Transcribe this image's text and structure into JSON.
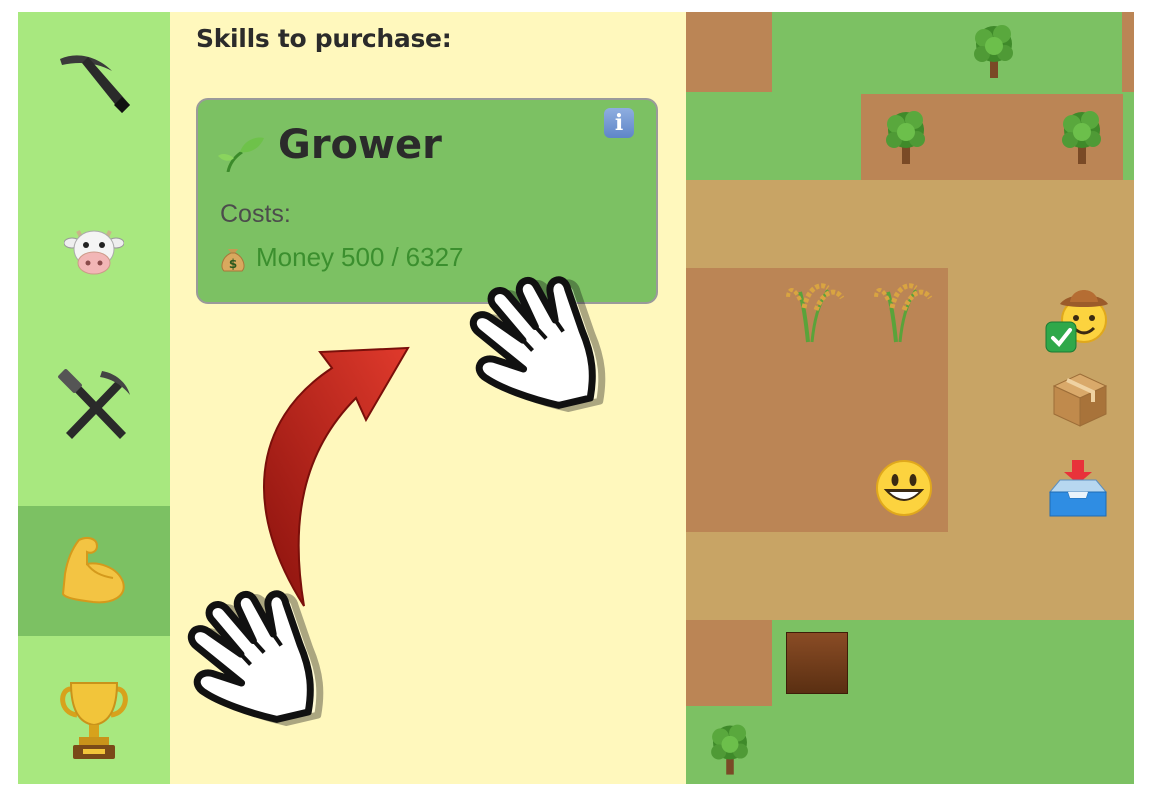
{
  "sidebar": {
    "items": [
      {
        "icon": "pickaxe-icon",
        "active": false
      },
      {
        "icon": "cow-icon",
        "active": false
      },
      {
        "icon": "hammer-and-pick-icon",
        "active": false
      },
      {
        "icon": "flexed-biceps-icon",
        "active": true
      },
      {
        "icon": "trophy-icon",
        "active": false
      }
    ]
  },
  "panel": {
    "title": "Skills to purchase:",
    "skill": {
      "name": "Grower",
      "icon": "seedling-icon",
      "costs_label": "Costs:",
      "cost_resource": "Money",
      "cost_amount": "500",
      "cost_separator": "/",
      "cost_available": "6327",
      "info_label": "i"
    }
  },
  "map": {
    "objects": [
      "tree-icon",
      "rice-plant-icon",
      "cowboy-face-icon",
      "checkmark-icon",
      "package-icon",
      "inbox-tray-icon",
      "grinning-face-icon",
      "wooden-crate-icon"
    ]
  },
  "colors": {
    "sidebar": "#a8e87f",
    "sidebar_active": "#7cc163",
    "panel": "#fff8bd",
    "card": "#7cc163",
    "grass": "#7cc163",
    "soil": "#bb8555",
    "path": "#c8a465",
    "arrow": "#c0241b"
  }
}
